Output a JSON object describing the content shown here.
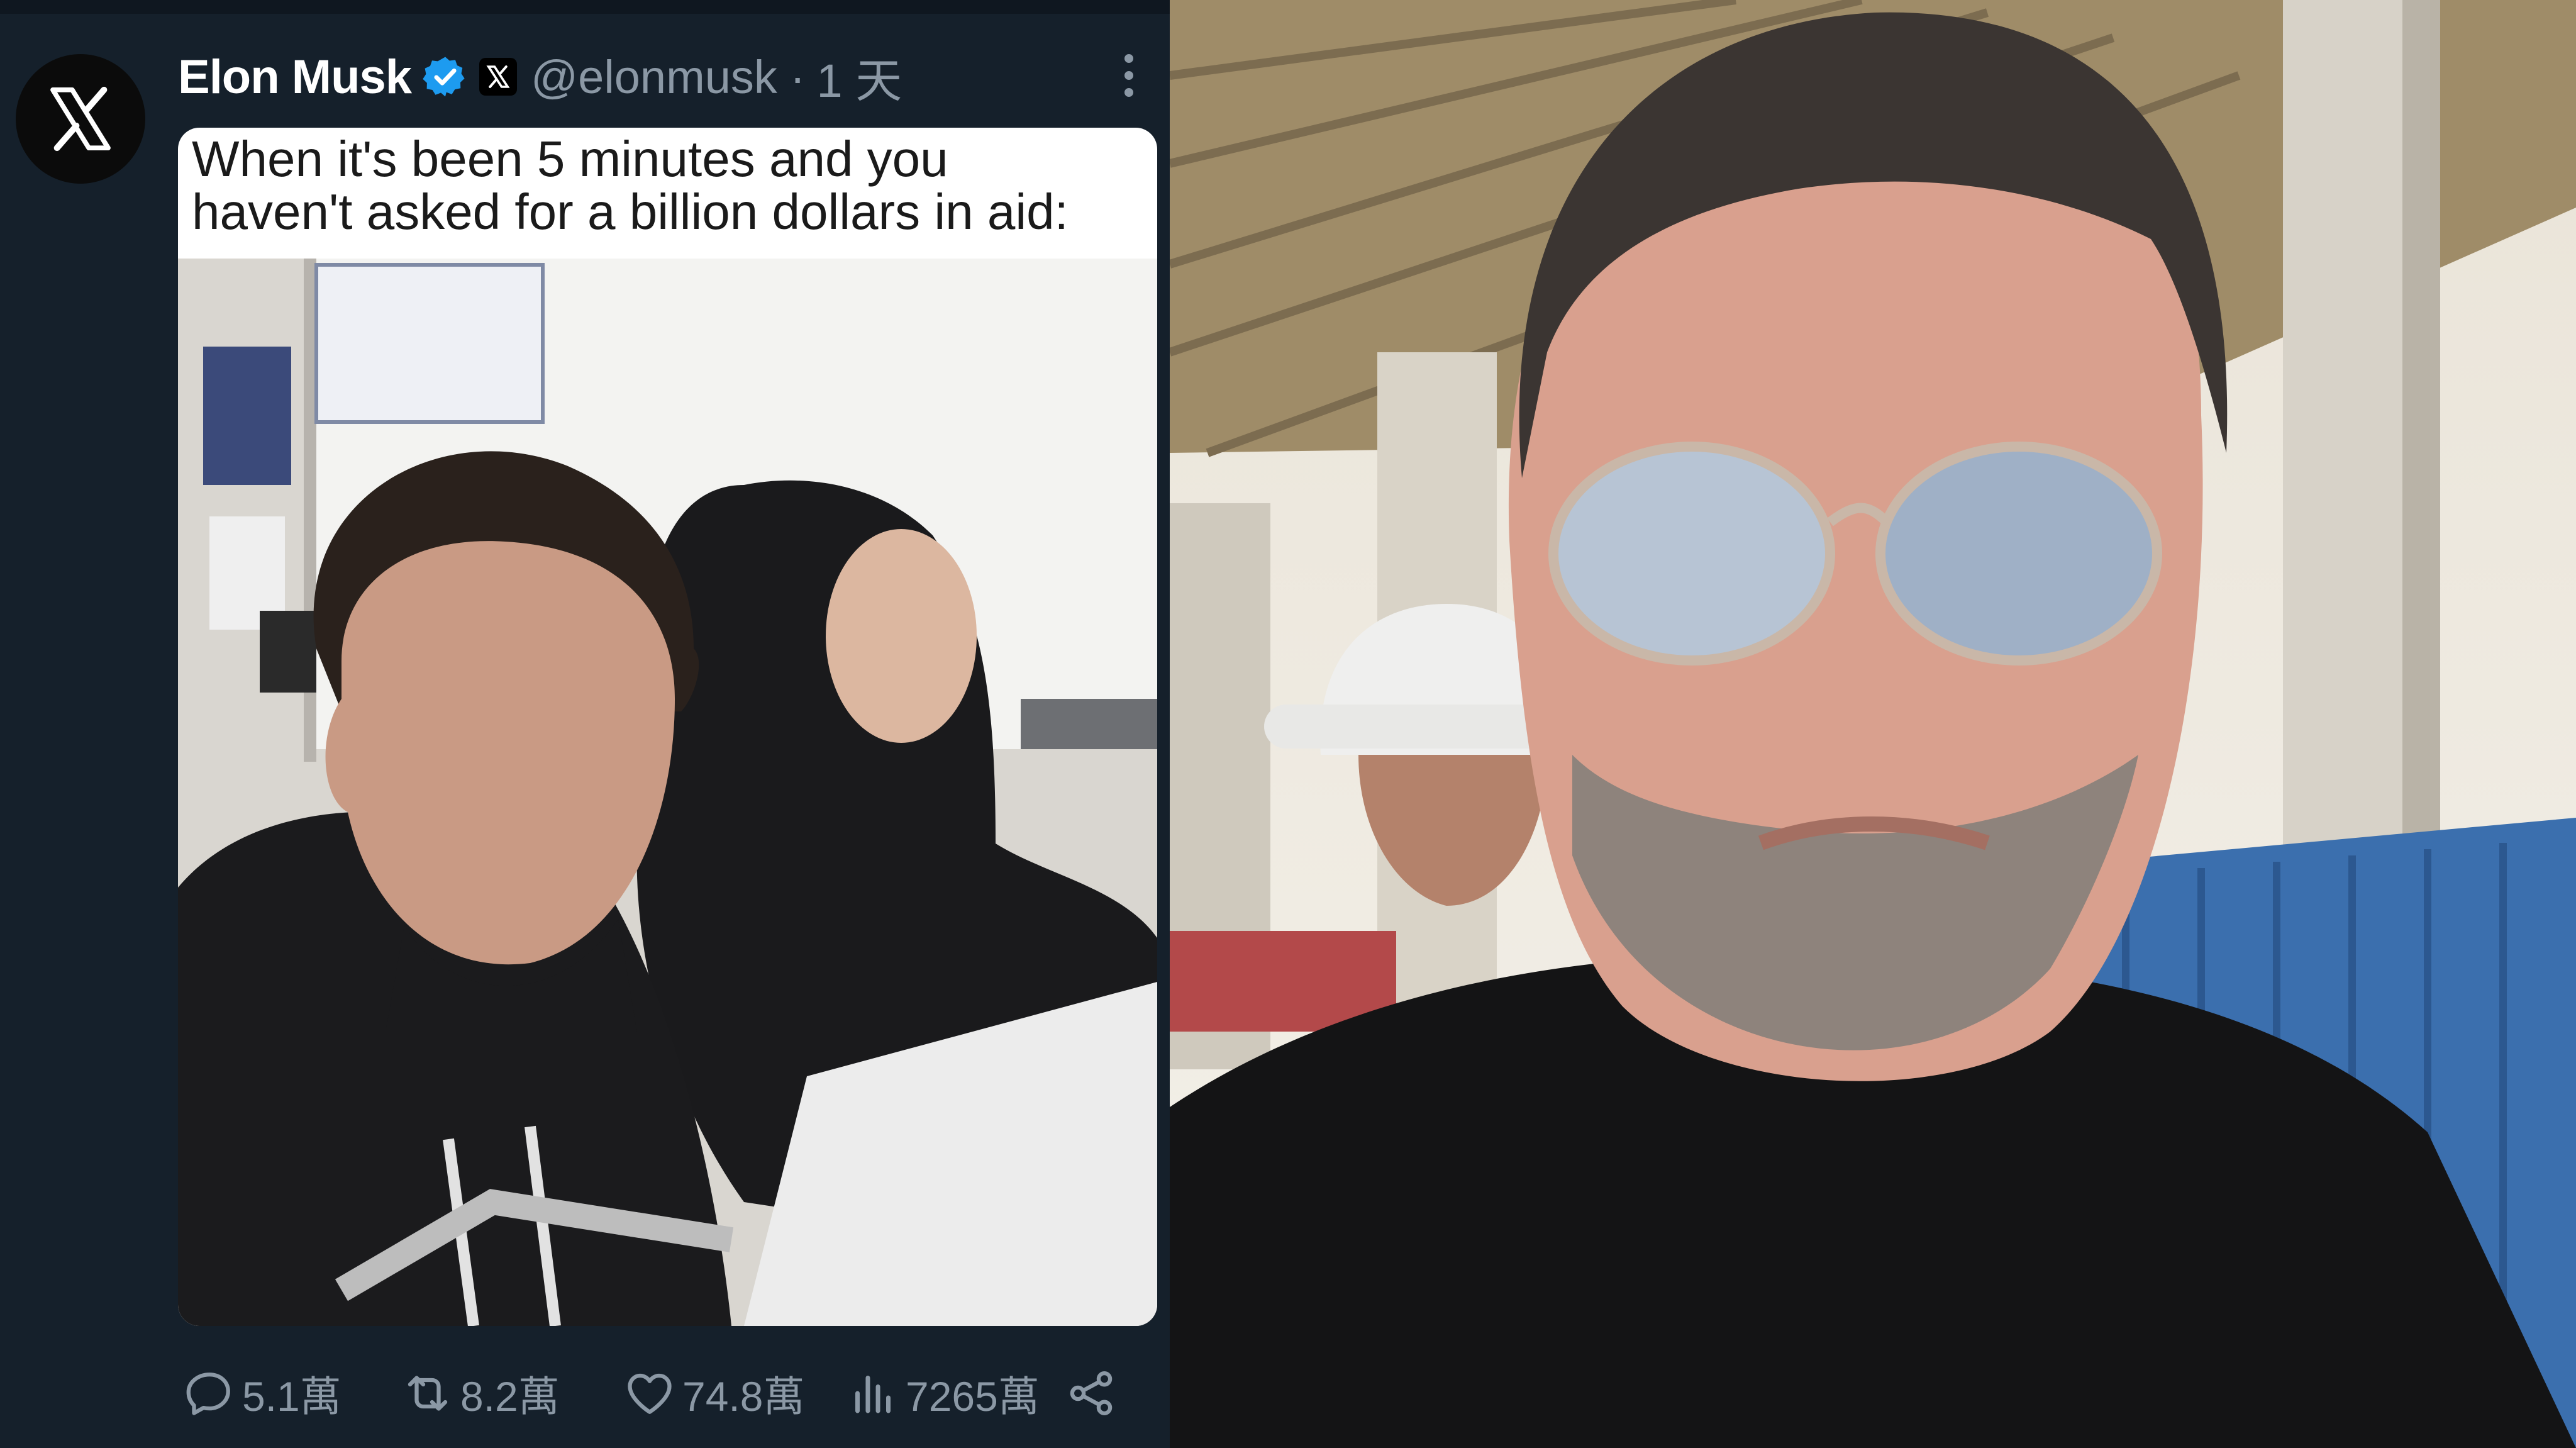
{
  "tweet": {
    "display_name": "Elon Musk",
    "handle": "@elonmusk",
    "separator": "·",
    "time": "1 天",
    "caption_line1": "When it's been 5 minutes and you",
    "caption_line2": "haven't asked for a billion dollars in aid:",
    "stats": {
      "replies": "5.1萬",
      "reposts": "8.2萬",
      "likes": "74.8萬",
      "views": "7265萬"
    }
  },
  "colors": {
    "background": "#15202b",
    "verified": "#1d9bf0",
    "secondary_text": "#8b98a5",
    "primary_text": "#ffffff"
  },
  "icons": [
    "x-logo-icon",
    "verified-badge-icon",
    "x-badge-icon",
    "more-options-icon",
    "reply-icon",
    "repost-icon",
    "like-icon",
    "views-icon",
    "share-icon"
  ]
}
